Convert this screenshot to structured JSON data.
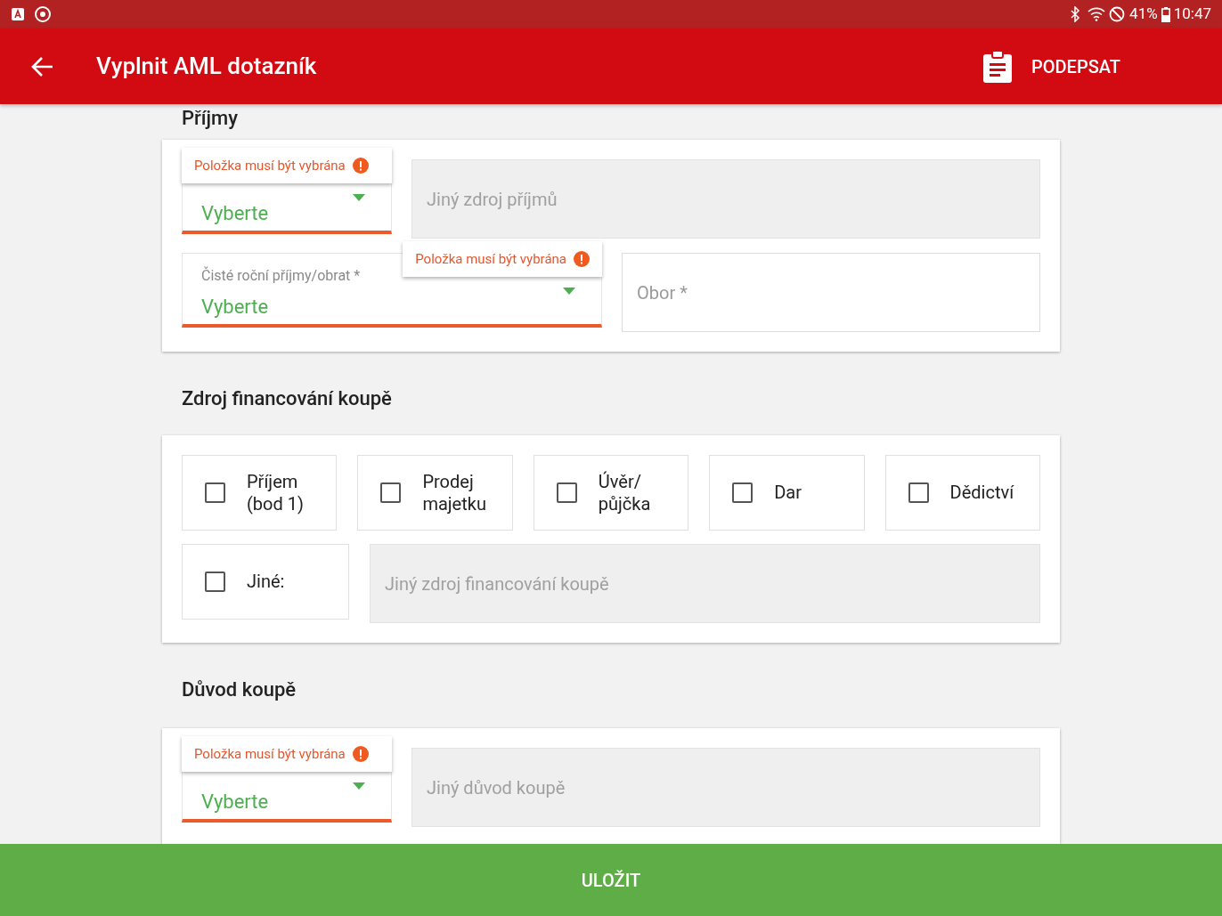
{
  "status_bar": {
    "battery": "41%",
    "time": "10:47"
  },
  "app_bar": {
    "title": "Vyplnit AML dotazník",
    "action": "PODEPSAT"
  },
  "income": {
    "heading": "Příjmy",
    "source_select": {
      "value": "Vyberte",
      "error": "Položka musí být vybrána",
      "invalid": true
    },
    "other_source": {
      "placeholder": "Jiný zdroj příjmů",
      "disabled": true
    },
    "net_income_select": {
      "label": "Čisté roční příjmy/obrat *",
      "value": "Vyberte",
      "error": "Položka musí být vybrána",
      "invalid": true
    },
    "field": {
      "placeholder": "Obor *",
      "disabled": false
    }
  },
  "financing": {
    "heading": "Zdroj financování koupě",
    "options": [
      {
        "label": "Příjem (bod 1)",
        "checked": false
      },
      {
        "label": "Prodej majetku",
        "checked": false
      },
      {
        "label": "Úvěr/ půjčka",
        "checked": false
      },
      {
        "label": "Dar",
        "checked": false
      },
      {
        "label": "Dědictví",
        "checked": false
      }
    ],
    "other": {
      "label": "Jiné:",
      "checked": false
    },
    "other_field": {
      "placeholder": "Jiný zdroj financování koupě",
      "disabled": true
    }
  },
  "reason": {
    "heading": "Důvod koupě",
    "select": {
      "value": "Vyberte",
      "error": "Položka musí být vybrána",
      "invalid": true
    },
    "other_field": {
      "placeholder": "Jiný důvod koupě",
      "disabled": true
    }
  },
  "save_button": "ULOŽIT"
}
